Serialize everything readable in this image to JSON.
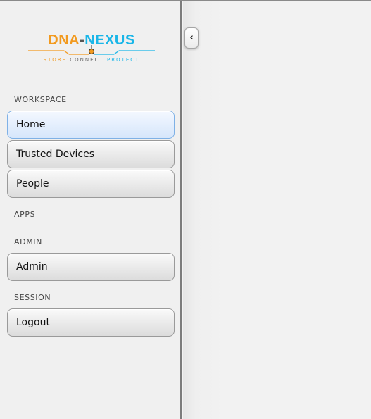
{
  "logo": {
    "dna": "DNA",
    "dash": "-",
    "nexus": "NEXUS",
    "tagline_store": "STORE",
    "tagline_connect": "CONNECT",
    "tagline_protect": "PROTECT",
    "colors": {
      "orange": "#f29a1f",
      "blue": "#1ab6e8"
    }
  },
  "sidebar": {
    "sections": {
      "workspace": "WORKSPACE",
      "apps": "APPS",
      "admin": "ADMIN",
      "session": "SESSION"
    },
    "items": {
      "home": "Home",
      "trusted_devices": "Trusted Devices",
      "people": "People",
      "admin": "Admin",
      "logout": "Logout"
    },
    "active_item": "Home"
  },
  "collapse_button": {
    "icon": "chevron-left-icon",
    "glyph": "‹"
  },
  "colors": {
    "active_item_bg": "#e3eefd",
    "active_item_border": "#7fb1e6"
  }
}
